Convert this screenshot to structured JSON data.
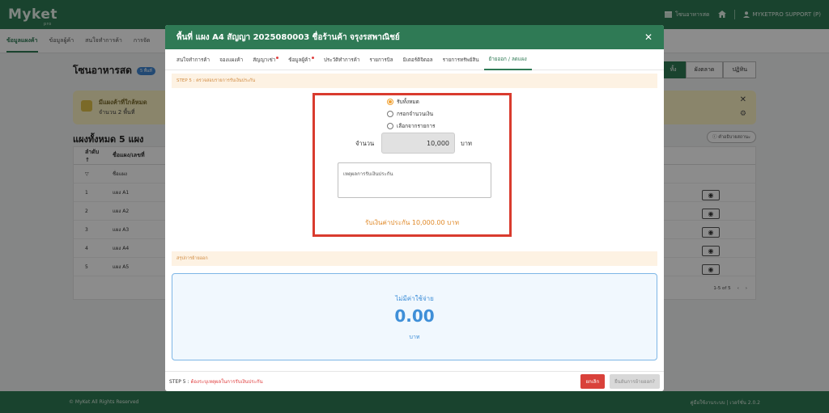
{
  "app": {
    "logo": "Myket",
    "logo_sub": "pro",
    "top_store": "โซนอาหารสด",
    "user": "MYKETPRO SUPPORT (P)"
  },
  "subnav": {
    "items": [
      "ข้อมูลแผงค้า",
      "ข้อมูลผู้ค้า",
      "สนใจทำการค้า",
      "การจัด"
    ]
  },
  "page": {
    "title": "โซนอาหารสด",
    "badge": "5 พื้นที่",
    "right_tabs": [
      "ทั้ง",
      "ผังตลาด",
      "ปฏิทิน"
    ],
    "banner_title": "มีแผงค้าที่ใกล้หมด",
    "banner_sub": "จำนวน 2 พื้นที่",
    "section_title": "แผงทั้งหมด 5 แผง",
    "help_btn": "คำอธิบายสถานะ",
    "table_headers": [
      "ลำดับ ↑",
      "ชื่อแผง/เลขที่"
    ],
    "filter_placeholder": "ชื่อแผง",
    "rows": [
      {
        "idx": "1",
        "name": "แผง A1"
      },
      {
        "idx": "2",
        "name": "แผง A2"
      },
      {
        "idx": "3",
        "name": "แผง A3"
      },
      {
        "idx": "4",
        "name": "แผง A4"
      },
      {
        "idx": "5",
        "name": "แผง A5"
      }
    ],
    "pager": "1-5 of 5"
  },
  "footer": {
    "left": "© MyKet All Rights Reserved",
    "right": "คู่มือใช้งานระบบ | เวอร์ชั่น 2.0.2"
  },
  "modal": {
    "title": "พื้นที่ แผง A4 สัญญา 2025080003 ชื่อร้านค้า จรุงรสพาณิชย์",
    "close_label": "✕",
    "tabs": [
      {
        "label": "สนใจทำการค้า",
        "dot": false
      },
      {
        "label": "จองแผงค้า",
        "dot": false
      },
      {
        "label": "สัญญาเช่า",
        "dot": true
      },
      {
        "label": "ข้อมูลผู้ค้า",
        "dot": true
      },
      {
        "label": "ประวัติทำการค้า",
        "dot": false
      },
      {
        "label": "รายการบิล",
        "dot": false
      },
      {
        "label": "มิเตอร์ดิจิตอล",
        "dot": false
      },
      {
        "label": "รายการทรัพย์สิน",
        "dot": false
      },
      {
        "label": "ย้ายออก / ลดแผง",
        "dot": false
      }
    ],
    "step_title": "STEP 5 : ตรวจสอบรายการรับเงินประกัน",
    "radio_options": [
      "รับทั้งหมด",
      "กรอกจำนวนเงิน",
      "เลือกจากรายการ"
    ],
    "selected_option": "รับทั้งหมด",
    "amount_label": "จำนวน",
    "amount_value": "10,000",
    "amount_unit": "บาท",
    "reason_placeholder": "เหตุผลการรับเงินประกัน",
    "deposit_total": "รับเงินค่าประกัน 10,000.00 บาท",
    "summary_title": "สรุปการย้ายออก",
    "cost_label": "ไม่มีค่าใช้จ่าย",
    "cost_value": "0.00",
    "cost_unit": "บาท",
    "footer_step": "STEP 5 :",
    "footer_note": " ต้องระบุเหตุผลในการรับเงินประกัน",
    "cancel_label": "ยกเลิก",
    "confirm_label": "ยืนยันการย้ายออก?"
  },
  "colors": {
    "brand_green": "#2f7a55",
    "highlight_red": "#d93b2e",
    "accent_orange": "#e08a2a",
    "info_blue": "#3f8fd8"
  }
}
